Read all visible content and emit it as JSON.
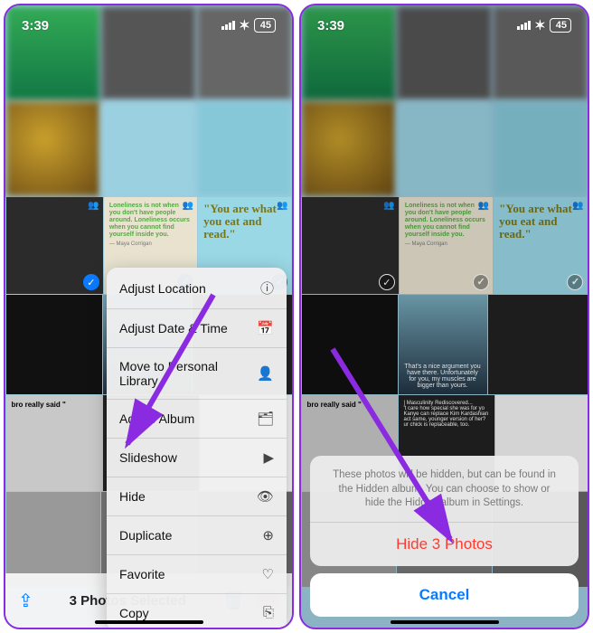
{
  "status": {
    "time": "3:39",
    "battery": "45"
  },
  "thumbs": {
    "quote1_text": "Loneliness is not when you don't have people around. Loneliness occurs when you cannot find yourself inside you.",
    "quote1_author": "— Maya Corrigan",
    "quote2_text": "\"You are what you eat and read.\"",
    "r3c1_text": "That's a nice argument you have there. Unfortunately for you, my muscles are bigger than yours.",
    "r4c0_text": "bro really said \"",
    "r4c1_lines": "| Masculinity Rediscovered...\n't care how special she was for yo\nKanye can replace Kim Kardashian\nact same, younger version of her?\nur chick is replaceable, too."
  },
  "menu": {
    "items": [
      {
        "label": "Adjust Location",
        "icon": "ⓘ"
      },
      {
        "label": "Adjust Date & Time",
        "icon": "📅"
      },
      {
        "label": "Move to Personal Library",
        "icon": "👤"
      },
      {
        "label": "Add to Album",
        "icon": "🗂"
      },
      {
        "label": "Slideshow",
        "icon": "▶︎"
      },
      {
        "label": "Hide",
        "icon": "👁"
      },
      {
        "label": "Duplicate",
        "icon": "⊕"
      },
      {
        "label": "Favorite",
        "icon": "♡"
      },
      {
        "label": "Copy",
        "icon": "⎘"
      }
    ]
  },
  "toolbar": {
    "selected_label": "3 Photos Selected"
  },
  "sheet": {
    "message": "These photos will be hidden, but can be found in the Hidden album. You can choose to show or hide the Hidden album in Settings.",
    "action": "Hide 3 Photos",
    "cancel": "Cancel"
  }
}
